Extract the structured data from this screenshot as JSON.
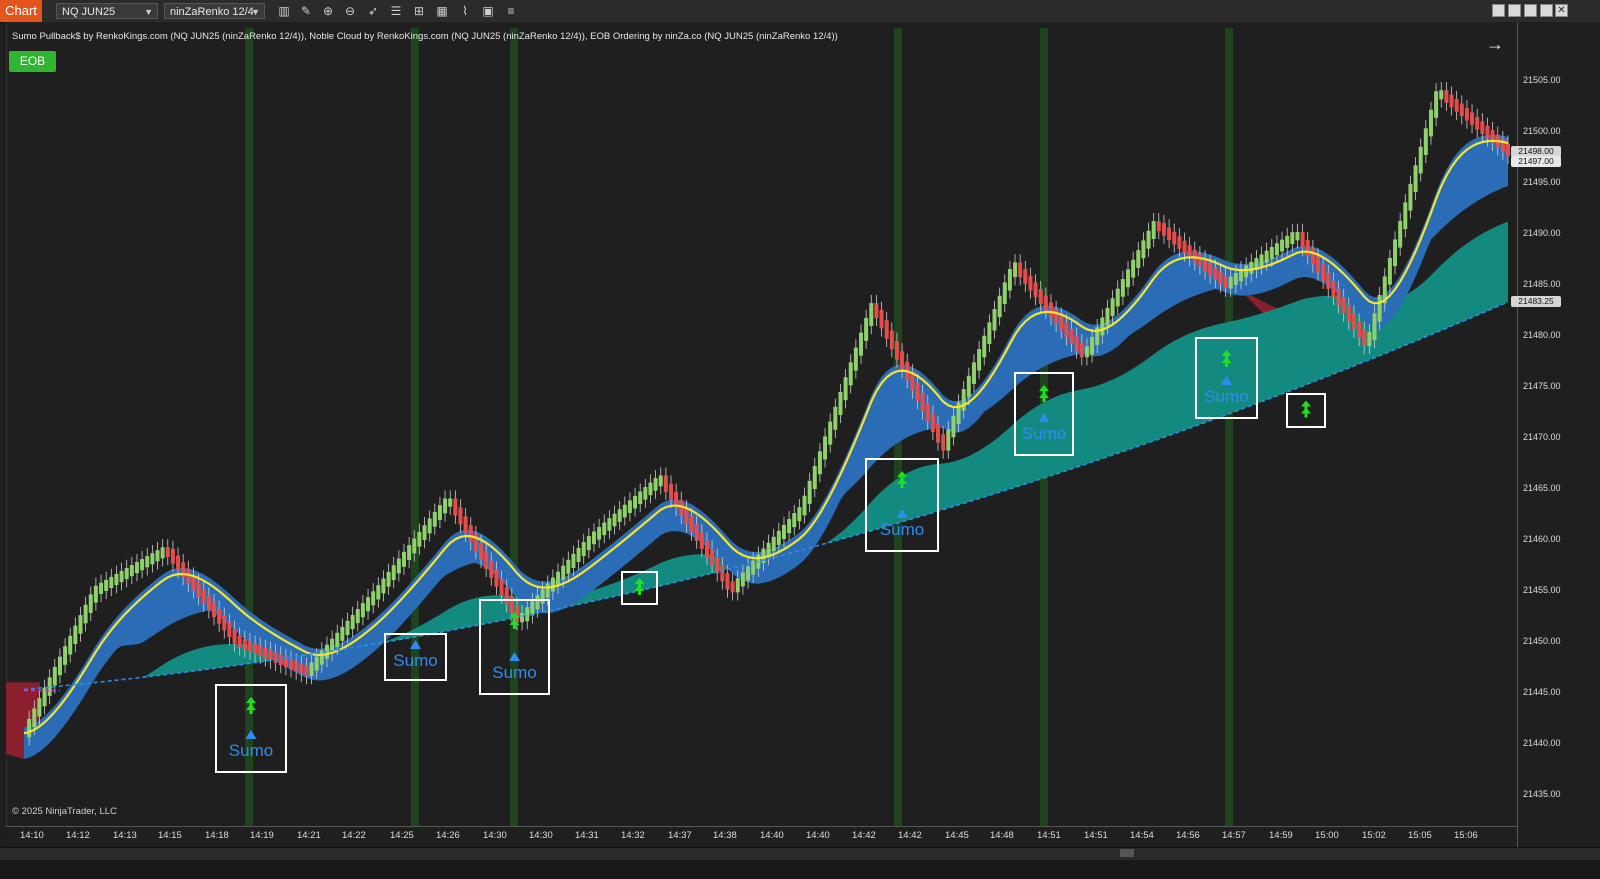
{
  "toolbar": {
    "chart_tab": "Chart",
    "instrument": "NQ JUN25",
    "bar_type": "ninZaRenko 12/4",
    "icons": [
      "bars-icon",
      "draw-pencil-icon",
      "zoom-in-icon",
      "zoom-out-icon",
      "pointer-icon",
      "properties-icon",
      "templates-icon",
      "indicators-icon",
      "strategies-icon",
      "data-box-icon",
      "more-list-icon"
    ],
    "window_buttons": [
      "restore-icon",
      "maximize-icon",
      "minimize-icon",
      "close-icon"
    ]
  },
  "chart": {
    "indicator_title": "Sumo Pullback$ by RenkoKings.com (NQ JUN25 (ninZaRenko 12/4)), Noble Cloud by RenkoKings.com (NQ JUN25 (ninZaRenko 12/4)), EOB Ordering by ninZa.co (NQ JUN25 (ninZaRenko 12/4))",
    "eob_button": "EOB",
    "copyright": "© 2025 NinjaTrader, LLC",
    "signal_label": "Sumo",
    "colors": {
      "bull_bar": "#8fd16a",
      "bear_bar": "#e74c4c",
      "cloud_blue": "#2a6cb5",
      "cloud_teal": "#138a80",
      "cloud_red": "#8b1f2d",
      "trend_line": "#f5e42c",
      "baseline": "#2a8fe0",
      "signal_green": "#1fe01f",
      "signal_blue": "#2f8cf0",
      "vband": "#1f4a1f"
    }
  },
  "price_axis": {
    "ticks": [
      "21505.00",
      "21500.00",
      "21495.00",
      "21490.00",
      "21485.00",
      "21480.00",
      "21475.00",
      "21470.00",
      "21465.00",
      "21460.00",
      "21455.00",
      "21450.00",
      "21445.00",
      "21440.00",
      "21435.00"
    ],
    "tags": [
      {
        "label": "21498.00",
        "bg": "#d6d6d6",
        "fg": "#111"
      },
      {
        "label": "21497.00",
        "bg": "#e8e8e8",
        "fg": "#111"
      },
      {
        "label": "21483.25",
        "bg": "#d6d6d6",
        "fg": "#111"
      }
    ]
  },
  "time_axis": {
    "ticks": [
      "14:10",
      "14:12",
      "14:13",
      "14:15",
      "14:18",
      "14:19",
      "14:21",
      "14:22",
      "14:25",
      "14:26",
      "14:30",
      "14:30",
      "14:31",
      "14:32",
      "14:37",
      "14:38",
      "14:40",
      "14:40",
      "14:42",
      "14:42",
      "14:45",
      "14:48",
      "14:51",
      "14:51",
      "14:54",
      "14:56",
      "14:57",
      "14:59",
      "15:00",
      "15:02",
      "15:05",
      "15:06"
    ]
  },
  "chart_data": {
    "type": "candlestick",
    "y_range": [
      21432.5,
      21508.5
    ],
    "key_prices": {
      "last": 21498.0,
      "trend": 21497.0,
      "baseline": 21483.25
    },
    "price_path": [
      21441,
      21455,
      21459,
      21450,
      21447,
      21455,
      21464,
      21452,
      21460,
      21466,
      21455,
      21463,
      21483,
      21469,
      21487,
      21478,
      21491,
      21485,
      21490,
      21479,
      21504,
      21498
    ],
    "signals": [
      "Sumo",
      "Sumo",
      "Sumo",
      "Sumo",
      "Sumo",
      "Sumo"
    ]
  }
}
